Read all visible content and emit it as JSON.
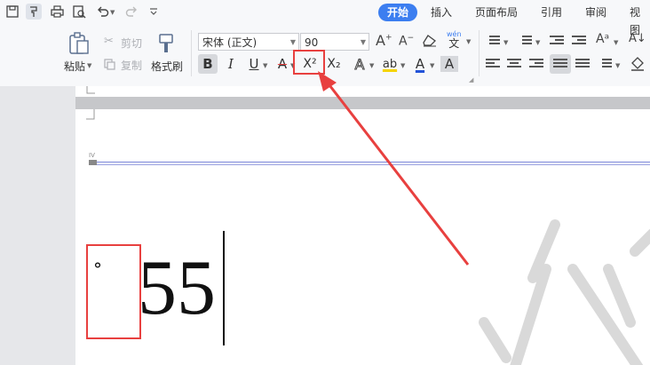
{
  "quick_access": {
    "icons": [
      "save-icon",
      "format-painter-icon",
      "print-icon",
      "print-preview-icon",
      "undo-icon",
      "redo-icon",
      "customize-icon"
    ]
  },
  "ribbon_tabs": [
    {
      "label": "开始",
      "active": true
    },
    {
      "label": "插入",
      "active": false
    },
    {
      "label": "页面布局",
      "active": false
    },
    {
      "label": "引用",
      "active": false
    },
    {
      "label": "审阅",
      "active": false
    },
    {
      "label": "视图",
      "active": false
    }
  ],
  "clipboard": {
    "paste_label": "粘贴",
    "cut_label": "剪切",
    "copy_label": "复制",
    "format_painter_label": "格式刷"
  },
  "font": {
    "family": "宋体 (正文)",
    "size": "90",
    "pinyin_glyph": "wén",
    "pinyin_char": "文"
  },
  "format_buttons": {
    "bold": "B",
    "italic": "I",
    "underline": "U",
    "strike": "A",
    "superscript": "X²",
    "subscript": "X₂",
    "effects": "A",
    "highlight": "ab",
    "font_color": "A",
    "char_shading": "A"
  },
  "document": {
    "ruler_marker": "IV",
    "degree_mark": "°",
    "text": "55"
  },
  "annotations": {
    "highlight_color": "#e8403f"
  }
}
